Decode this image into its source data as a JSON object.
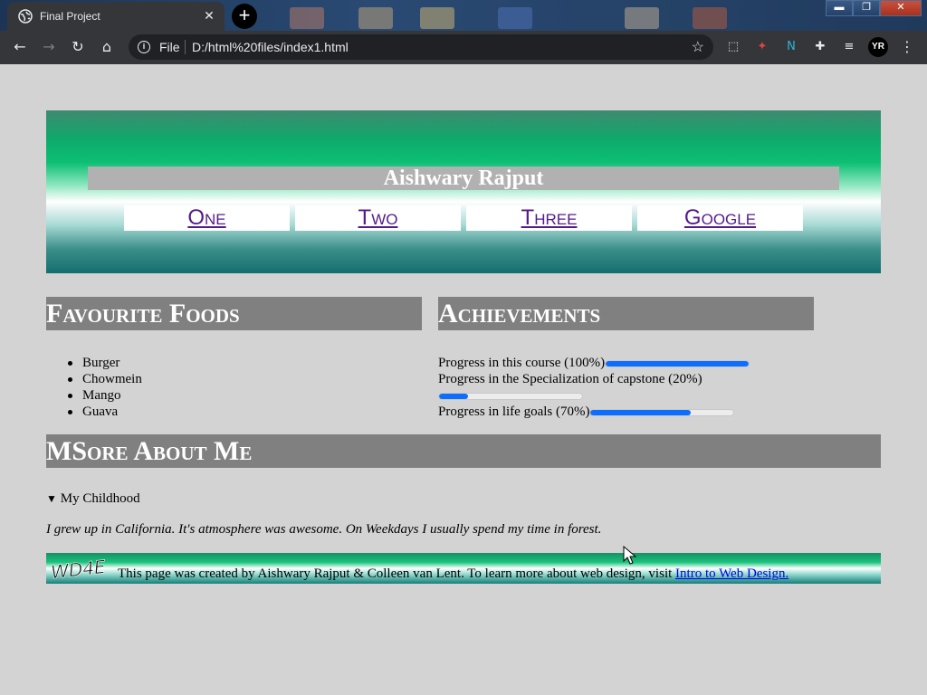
{
  "browser": {
    "tab_title": "Final Project",
    "address_scheme": "File",
    "address_url": "D:/html%20files/index1.html",
    "profile_initials": "YR"
  },
  "header": {
    "name": "Aishwary Rajput",
    "nav": [
      "One",
      "Two",
      "Three",
      "Google"
    ]
  },
  "sections": {
    "foods_title": "Favourite Foods",
    "achievements_title": "Achievements",
    "about_title": "MSore About Me"
  },
  "foods": [
    "Burger",
    "Chowmein",
    "Mango",
    "Guava"
  ],
  "achievements": [
    {
      "label": "Progress in this course (100%)",
      "value": 100
    },
    {
      "label": "Progress in the Specialization of capstone (20%)",
      "value": 20
    },
    {
      "label": "Progress in life goals (70%)",
      "value": 70
    }
  ],
  "about": {
    "summary": "My Childhood",
    "text": "I grew up in California. It's atmosphere was awesome. On Weekdays I usually spend my time in forest."
  },
  "footer": {
    "logo_text": "WD4E",
    "text": "This page was created by Aishwary Rajput & Colleen van Lent. To learn more about web design, visit ",
    "link": "Intro to Web Design."
  },
  "colors": {
    "progress_fill": "#0d6efd",
    "nav_link": "#551a8b",
    "section_header": "#808080"
  }
}
